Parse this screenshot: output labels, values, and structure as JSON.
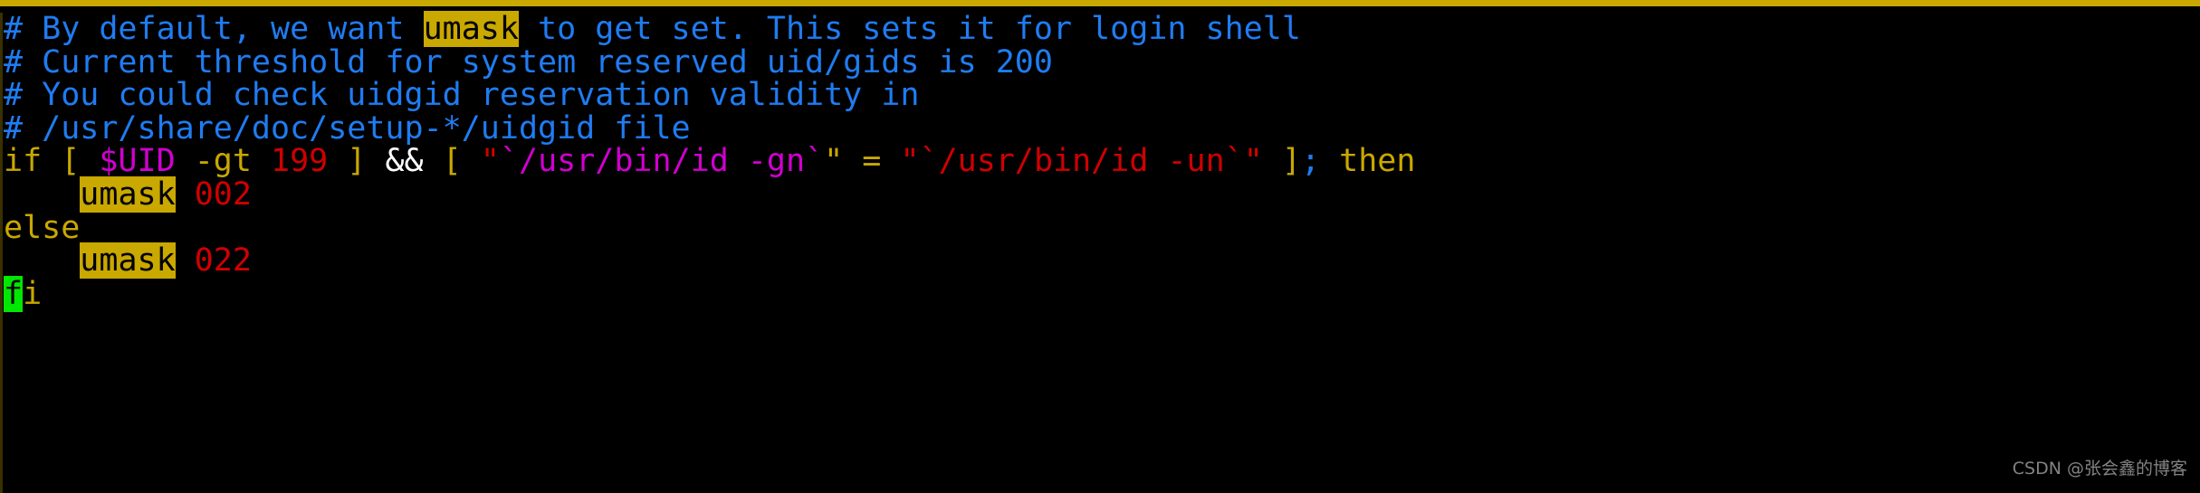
{
  "app": {
    "kind": "terminal-text-editor",
    "background_color": "#000000",
    "top_border_color": "#c9a800"
  },
  "theme": {
    "comment_color": "#1f7cf2",
    "keyword_color": "#c9a800",
    "number_color": "#d00000",
    "variable_color": "#d000d0",
    "string_color": "#d00000",
    "command_substitution_color": "#d000d0",
    "operator_color": "#ffffff",
    "punctuation_color": "#1f7cf2",
    "search_highlight_bg": "#c9a800",
    "search_highlight_fg": "#000000",
    "cursor_bg": "#00e800",
    "cursor_fg": "#000000",
    "watermark_color": "#9a9a9a"
  },
  "lines": [
    {
      "id": "line-1",
      "type": "comment",
      "text": "# By default, we want umask to get set. This sets it for login shell",
      "segments": [
        {
          "t": "# By default, we want ",
          "c": "tok-comment"
        },
        {
          "t": "umask",
          "c": "tok-comment hl-search"
        },
        {
          "t": " to get set. This sets it for login shell",
          "c": "tok-comment"
        }
      ]
    },
    {
      "id": "line-2",
      "type": "comment",
      "text": "# Current threshold for system reserved uid/gids is 200",
      "segments": [
        {
          "t": "# Current threshold for system reserved uid/gids is 200",
          "c": "tok-comment"
        }
      ]
    },
    {
      "id": "line-3",
      "type": "comment",
      "text": "# You could check uidgid reservation validity in",
      "segments": [
        {
          "t": "# You could check uidgid reservation validity in",
          "c": "tok-comment"
        }
      ]
    },
    {
      "id": "line-4",
      "type": "comment",
      "text": "# /usr/share/doc/setup-*/uidgid file",
      "segments": [
        {
          "t": "# /usr/share/doc/setup-*/uidgid file",
          "c": "tok-comment"
        }
      ]
    },
    {
      "id": "line-5",
      "type": "code",
      "text": "if [ $UID -gt 199 ] && [ \"`/usr/bin/id -gn`\" = \"`/usr/bin/id -un`\" ]; then",
      "segments": [
        {
          "t": "if [ ",
          "c": "tok-keyword"
        },
        {
          "t": "$UID",
          "c": "tok-var"
        },
        {
          "t": " -gt ",
          "c": "tok-keyword"
        },
        {
          "t": "199",
          "c": "tok-number"
        },
        {
          "t": " ]",
          "c": "tok-keyword"
        },
        {
          "t": " ",
          "c": "tok-keyword"
        },
        {
          "t": "&&",
          "c": "tok-operator"
        },
        {
          "t": " [ ",
          "c": "tok-keyword"
        },
        {
          "t": "\"",
          "c": "tok-string"
        },
        {
          "t": "`/usr/bin/id -gn`",
          "c": "tok-cmdsub"
        },
        {
          "t": "\"",
          "c": "tok-keyword"
        },
        {
          "t": " = ",
          "c": "tok-keyword"
        },
        {
          "t": "\"`/usr/bin/id -un`\"",
          "c": "tok-string"
        },
        {
          "t": " ]",
          "c": "tok-keyword"
        },
        {
          "t": ";",
          "c": "tok-punct"
        },
        {
          "t": " then",
          "c": "tok-keyword"
        }
      ]
    },
    {
      "id": "line-6",
      "type": "code",
      "text": "    umask 002",
      "segments": [
        {
          "t": "    ",
          "c": "tok-plain"
        },
        {
          "t": "umask",
          "c": "hl-search"
        },
        {
          "t": " ",
          "c": "tok-plain"
        },
        {
          "t": "002",
          "c": "tok-number"
        }
      ]
    },
    {
      "id": "line-7",
      "type": "code",
      "text": "else",
      "segments": [
        {
          "t": "else",
          "c": "tok-keyword"
        }
      ]
    },
    {
      "id": "line-8",
      "type": "code",
      "text": "    umask 022",
      "segments": [
        {
          "t": "    ",
          "c": "tok-plain"
        },
        {
          "t": "umask",
          "c": "hl-search"
        },
        {
          "t": " ",
          "c": "tok-plain"
        },
        {
          "t": "022",
          "c": "tok-number"
        }
      ]
    },
    {
      "id": "line-9",
      "type": "code",
      "text": "fi",
      "segments": [
        {
          "t": "f",
          "c": "hl-cursor"
        },
        {
          "t": "i",
          "c": "tok-keyword"
        }
      ]
    }
  ],
  "watermark": {
    "text": "CSDN @张会鑫的博客"
  }
}
